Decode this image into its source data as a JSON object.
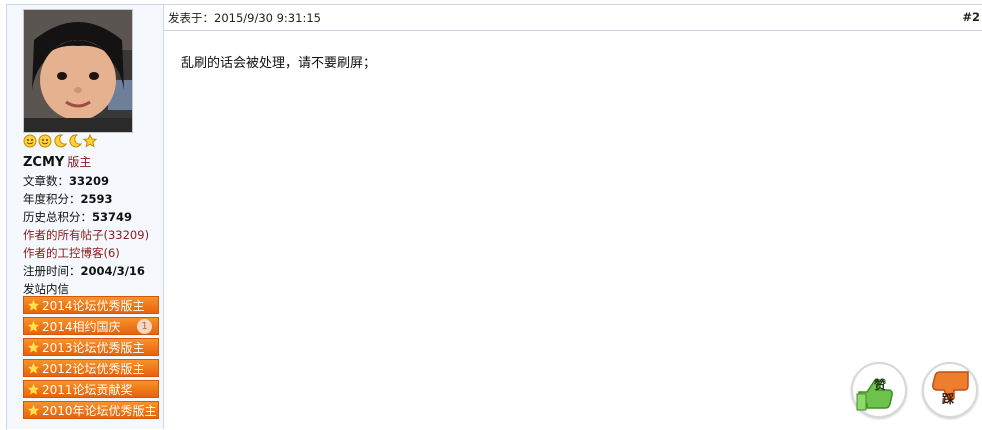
{
  "user": {
    "name": "ZCMY",
    "role": "版主",
    "articles_label": "文章数：",
    "articles_value": "33209",
    "year_points_label": "年度积分：",
    "year_points_value": "2593",
    "total_points_label": "历史总积分：",
    "total_points_value": "53749",
    "all_posts_link": "作者的所有帖子(33209)",
    "blog_link": "作者的工控博客(6)",
    "register_label": "注册时间：",
    "register_value": "2004/3/16",
    "message_link": "发站内信",
    "rank_icons": [
      "smiley-icon",
      "smiley-icon",
      "moon-icon",
      "moon-icon",
      "star-icon"
    ]
  },
  "badges": [
    {
      "label": "2014论坛优秀版主"
    },
    {
      "label": "2014相约国庆",
      "count": "1"
    },
    {
      "label": "2013论坛优秀版主"
    },
    {
      "label": "2012论坛优秀版主"
    },
    {
      "label": "2011论坛贡献奖"
    },
    {
      "label": "2010年论坛优秀版主"
    }
  ],
  "post": {
    "date_label": "发表于：2015/9/30 9:31:15",
    "floor": "#2",
    "body": "乱刷的话会被处理，请不要刷屏；"
  },
  "actions": {
    "like_label": "赞",
    "dislike_label": "踩"
  },
  "colors": {
    "border": "#c9d9ea",
    "sidebar_bg": "#f5f8fc",
    "link": "#8b1a1a",
    "badge": "#ef7a1a"
  }
}
